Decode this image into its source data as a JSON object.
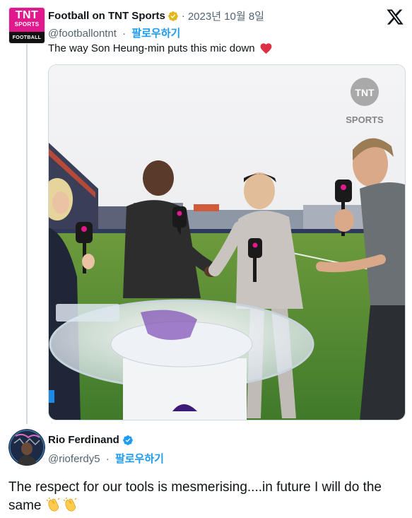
{
  "quoted_tweet": {
    "display_name": "Football on TNT Sports",
    "separator": "·",
    "date": "2023년 10월 8일",
    "handle": "@footballontnt",
    "follow_label": "팔로우하기",
    "text": "The way Son Heung-min puts this mic down",
    "avatar": {
      "brand_top": "TNT",
      "brand_middle": "SPORTS",
      "brand_bottom": "FOOTBALL",
      "brand_color": "#e2188d"
    },
    "verified_badge": "gold-verified-badge-icon",
    "emoji": "red-heart-icon",
    "media": {
      "watermark": "TNT SPORTS",
      "type": "video-frame"
    }
  },
  "reply_tweet": {
    "display_name": "Rio Ferdinand",
    "separator": "·",
    "handle": "@rioferdy5",
    "follow_label": "팔로우하기",
    "text": "The respect for our tools is mesmerising....in future I will do the same",
    "emoji": [
      "clapping-hands-icon",
      "clapping-hands-icon"
    ],
    "verified_badge": "blue-verified-badge-icon"
  },
  "colors": {
    "link": "#1d9bf0",
    "secondary_text": "#536471",
    "primary_text": "#0f1419",
    "verified_gold": "#e2b719",
    "verified_blue": "#1d9bf0"
  }
}
